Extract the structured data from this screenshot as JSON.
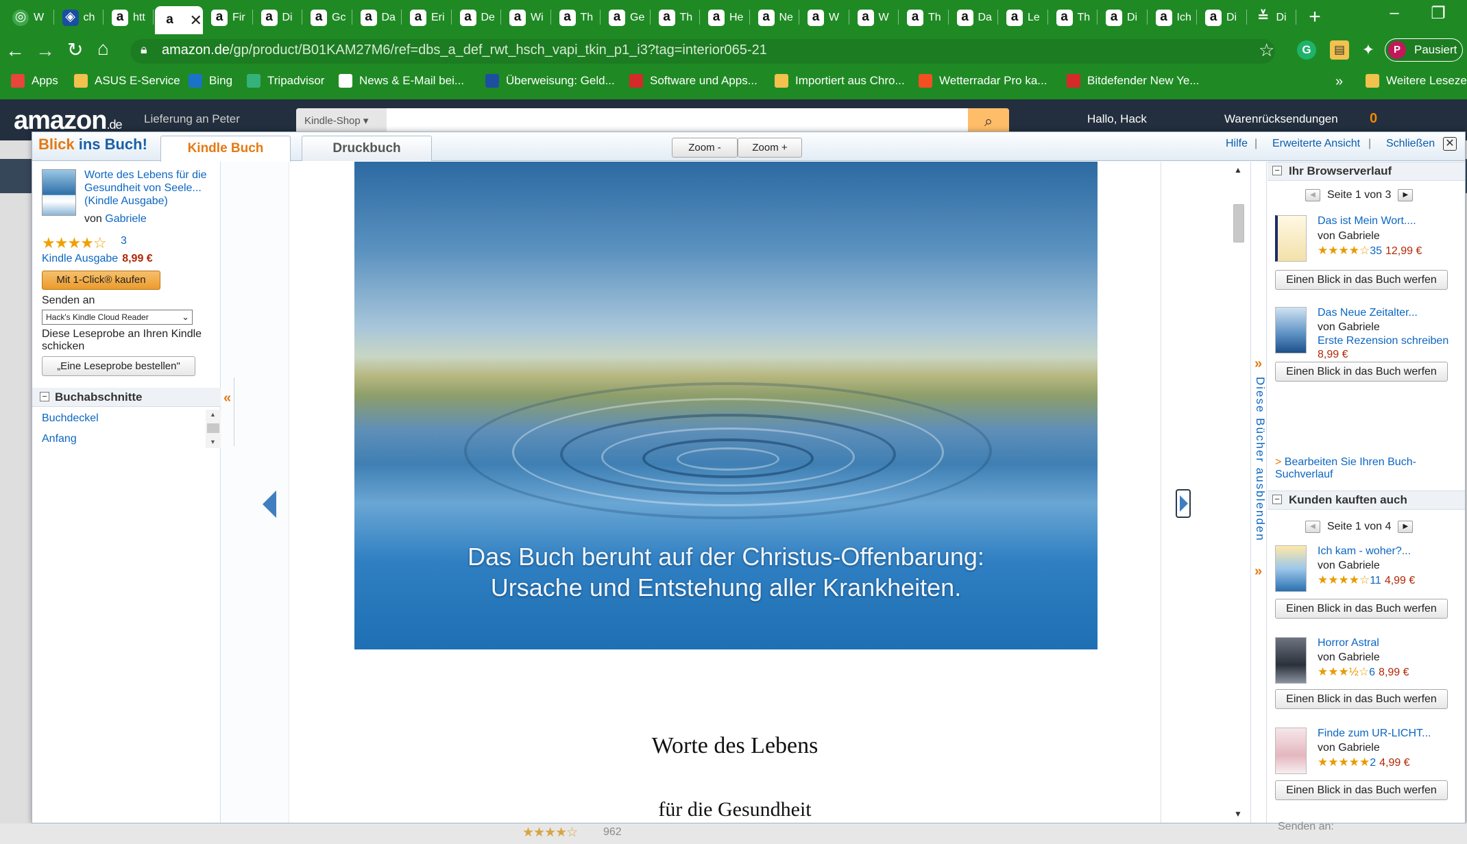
{
  "browser": {
    "tabs": [
      {
        "icon": "globe",
        "label": "W",
        "active": false
      },
      {
        "icon": "chrome",
        "label": "ch",
        "active": false
      },
      {
        "icon": "amazon",
        "label": "htt",
        "active": false
      },
      {
        "icon": "amazon",
        "label": "",
        "active": true
      },
      {
        "icon": "amazon",
        "label": "Fir",
        "active": false
      },
      {
        "icon": "amazon",
        "label": "Di",
        "active": false
      },
      {
        "icon": "amazon",
        "label": "Gc",
        "active": false
      },
      {
        "icon": "amazon",
        "label": "Da",
        "active": false
      },
      {
        "icon": "amazon",
        "label": "Eri",
        "active": false
      },
      {
        "icon": "amazon",
        "label": "De",
        "active": false
      },
      {
        "icon": "amazon",
        "label": "Wi",
        "active": false
      },
      {
        "icon": "amazon",
        "label": "Th",
        "active": false
      },
      {
        "icon": "amazon",
        "label": "Ge",
        "active": false
      },
      {
        "icon": "amazon",
        "label": "Th",
        "active": false
      },
      {
        "icon": "amazon",
        "label": "He",
        "active": false
      },
      {
        "icon": "amazon",
        "label": "Ne",
        "active": false
      },
      {
        "icon": "amazon",
        "label": "W",
        "active": false
      },
      {
        "icon": "amazon",
        "label": "W",
        "active": false
      },
      {
        "icon": "amazon",
        "label": "Th",
        "active": false
      },
      {
        "icon": "amazon",
        "label": "Da",
        "active": false
      },
      {
        "icon": "amazon",
        "label": "Le",
        "active": false
      },
      {
        "icon": "amazon",
        "label": "Th",
        "active": false
      },
      {
        "icon": "amazon",
        "label": "Di",
        "active": false
      },
      {
        "icon": "amazon",
        "label": "Ich",
        "active": false
      },
      {
        "icon": "amazon",
        "label": "Di",
        "active": false
      },
      {
        "icon": "settings",
        "label": "Di",
        "active": false
      }
    ],
    "new_tab": "+",
    "window_buttons": [
      "–",
      "❐"
    ],
    "url_host": "amazon.de",
    "url_path": "/gp/product/B01KAM27M6/ref=dbs_a_def_rwt_hsch_vapi_tkin_p1_i3?tag=interior065-21",
    "profile_initial": "P",
    "profile_status": "Pausiert",
    "bookmarks": [
      {
        "label": "Apps",
        "icon": "apps-icon",
        "color": "#e8453c"
      },
      {
        "label": "ASUS E-Service",
        "icon": "folder-icon",
        "color": "#f2c14e"
      },
      {
        "label": "Bing",
        "icon": "bing-icon",
        "color": "#1a73c7"
      },
      {
        "label": "Tripadvisor",
        "icon": "tripadvisor-icon",
        "color": "#34b27a"
      },
      {
        "label": "News & E-Mail bei...",
        "icon": "tonline-icon",
        "color": "#ffffff"
      },
      {
        "label": "Überweisung: Geld...",
        "icon": "paypal-icon",
        "color": "#1d4fa0"
      },
      {
        "label": "Software und Apps...",
        "icon": "chip-icon",
        "color": "#d42a2a"
      },
      {
        "label": "Importiert aus Chro...",
        "icon": "folder-icon",
        "color": "#f2c14e"
      },
      {
        "label": "Wetterradar Pro ka...",
        "icon": "windows-icon",
        "color": "#f25022"
      },
      {
        "label": "Bitdefender New Ye...",
        "icon": "bitdefender-icon",
        "color": "#d42a2a"
      }
    ],
    "bookmarks_more": "»",
    "other_bookmarks": "Weitere Lesezei"
  },
  "amazon_header": {
    "logo": "amazon",
    "logo_tld": ".de",
    "delivery_line": "Lieferung an Peter",
    "search_category": "Kindle-Shop ▾",
    "greeting": "Hallo, Hack",
    "returns": "Warenrücksendungen",
    "cart_count": "0"
  },
  "viewer": {
    "brand_part1": "Blick",
    "brand_part2": " ins Buch!",
    "tabs": {
      "kindle": "Kindle Buch",
      "print": "Druckbuch"
    },
    "zoom_out": "Zoom -",
    "zoom_in": "Zoom +",
    "help": "Hilfe",
    "extended_view": "Erweiterte Ansicht",
    "close": "Schließen",
    "close_symbol": "✕"
  },
  "left_panel": {
    "book_title": "Worte des Lebens für die Gesundheit von Seele... (Kindle Ausgabe)",
    "by_label": "von",
    "author": "Gabriele",
    "stars": "★★★★☆",
    "rating_value": 4,
    "rating_count": "3",
    "format": "Kindle Ausgabe",
    "price": "8,99 €",
    "buy_button": "Mit 1-Click® kaufen",
    "send_to_label": "Senden an",
    "device": "Hack's Kindle Cloud Reader",
    "sample_text": "Diese Leseprobe an Ihren Kindle schicken",
    "sample_button": "„Eine Leseprobe bestellen\"",
    "sections_title": "Buchabschnitte",
    "sections": [
      "Buchdeckel",
      "Anfang"
    ],
    "collapse": "«"
  },
  "reader": {
    "image_caption_line1": "Das Buch beruht auf der Christus-Offenbarung:",
    "image_caption_line2": "Ursache und Entstehung aller Krankheiten.",
    "title_line1": "Worte des Lebens",
    "title_line2": "für die Gesundheit"
  },
  "right_panel": {
    "hide_label": "Diese Bücher ausblenden",
    "history_title": "Ihr Browserverlauf",
    "history_pager": "Seite 1 von 3",
    "history_items": [
      {
        "title": "Das ist Mein Wort....",
        "by": "von Gabriele",
        "stars": "★★★★☆",
        "rating": 4,
        "count": "35",
        "price": "12,99 €",
        "button": "Einen Blick in das Buch werfen"
      },
      {
        "title": "Das Neue Zeitalter...",
        "by": "von Gabriele",
        "review": "Erste Rezension schreiben",
        "price": "8,99 €",
        "button": "Einen Blick in das Buch werfen"
      }
    ],
    "edit_history": "Bearbeiten Sie Ihren Buch-Suchverlauf",
    "edit_prefix": ">",
    "also_bought_title": "Kunden kauften auch",
    "also_bought_pager": "Seite 1 von 4",
    "also_bought_items": [
      {
        "title": "Ich kam - woher?...",
        "by": "von Gabriele",
        "stars": "★★★★☆",
        "rating": 4,
        "count": "11",
        "price": "4,99 €",
        "button": "Einen Blick in das Buch werfen"
      },
      {
        "title": "Horror Astral",
        "by": "von Gabriele",
        "stars": "★★★½☆",
        "rating": 3.5,
        "count": "6",
        "price": "8,99 €",
        "button": "Einen Blick in das Buch werfen"
      },
      {
        "title": "Finde zum UR-LICHT...",
        "by": "von Gabriele",
        "stars": "★★★★★",
        "rating": 5,
        "count": "2",
        "price": "4,99 €",
        "button": "Einen Blick in das Buch werfen"
      }
    ]
  },
  "background": {
    "rating_count": "962",
    "send_to": "Senden an:"
  }
}
